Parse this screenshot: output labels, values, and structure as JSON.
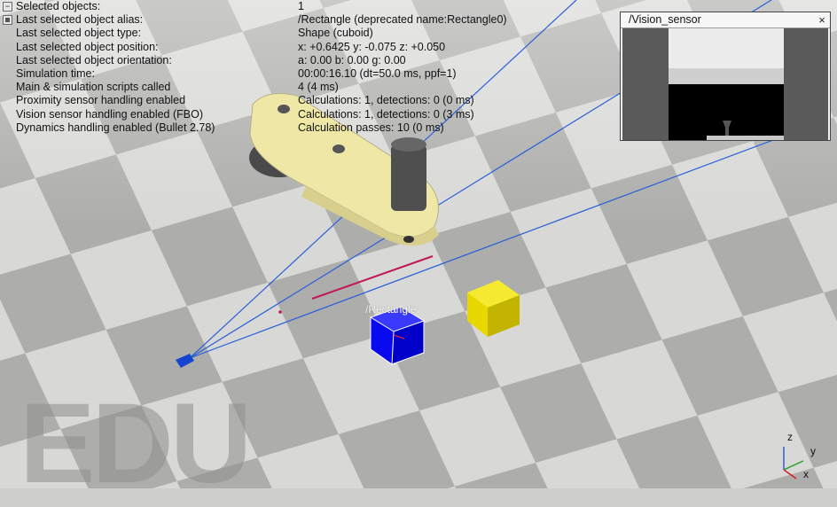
{
  "info_panel": {
    "rows": [
      {
        "label": "Selected objects:",
        "value": "1",
        "toggle": "minus"
      },
      {
        "label": "Last selected object alias:",
        "value": "/Rectangle    (deprecated name:Rectangle0)",
        "toggle": "square"
      },
      {
        "label": "Last selected object type:",
        "value": "Shape (cuboid)"
      },
      {
        "label": "Last selected object position:",
        "value": "x: +0.6425    y: -0.075    z: +0.050"
      },
      {
        "label": "Last selected object orientation:",
        "value": "a: 0.00    b: 0.00    g: 0.00"
      },
      {
        "label": "Simulation time:",
        "value": "00:00:16.10 (dt=50.0 ms, ppf=1)"
      },
      {
        "label": "Main & simulation scripts called",
        "value": "4 (4 ms)"
      },
      {
        "label": "Proximity sensor handling enabled",
        "value": "Calculations: 1, detections: 0 (0 ms)"
      },
      {
        "label": "Vision sensor handling enabled (FBO)",
        "value": "Calculations: 1, detections: 0 (3 ms)"
      },
      {
        "label": "Dynamics handling enabled (Bullet 2.78)",
        "value": "Calculation passes: 10 (0 ms)"
      }
    ]
  },
  "vision_sensor_window": {
    "title": "/Vision_sensor",
    "close_glyph": "×"
  },
  "scene": {
    "selected_object_label": "/Rectangle",
    "watermark": "EDU",
    "axes": {
      "z": "z",
      "y": "y",
      "x": "x"
    },
    "colors": {
      "floor_light": "#d8d8d6",
      "floor_dark": "#a9a9a7",
      "sensor_rays": "#2a5fd8",
      "robot_arm": "#efe7a5",
      "robot_joint": "#4a4a4a",
      "blue_cube": "#0a0af0",
      "yellow_cube": "#e8d800",
      "laser_line": "#c0185a"
    }
  }
}
